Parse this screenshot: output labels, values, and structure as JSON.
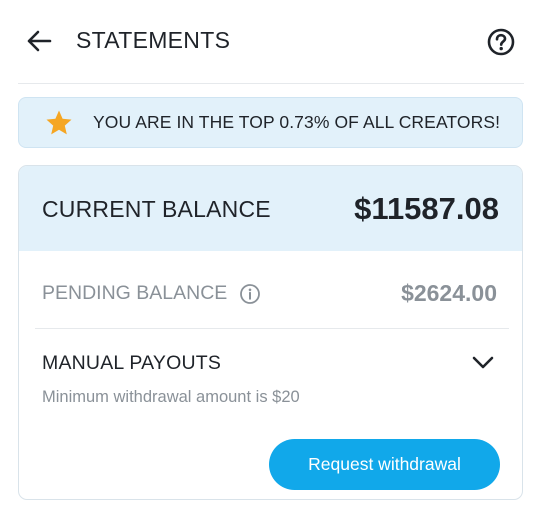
{
  "header": {
    "title": "STATEMENTS",
    "back_icon": "arrow-left-icon",
    "help_icon": "question-circle-icon"
  },
  "banner": {
    "icon": "star-icon",
    "text": "YOU ARE IN THE TOP 0.73% OF ALL CREATORS!",
    "star_color": "#f5a623"
  },
  "balance": {
    "current_label": "CURRENT BALANCE",
    "current_value": "$11587.08",
    "pending_label": "PENDING BALANCE",
    "pending_value": "$2624.00",
    "info_icon": "info-circle-icon"
  },
  "payouts": {
    "label": "MANUAL PAYOUTS",
    "note": "Minimum withdrawal amount is $20",
    "expand_icon": "chevron-down-icon",
    "button_label": "Request withdrawal"
  },
  "colors": {
    "accent": "#11a8ea",
    "highlight_bg": "#e2f1fa",
    "muted_text": "#8a9198"
  }
}
